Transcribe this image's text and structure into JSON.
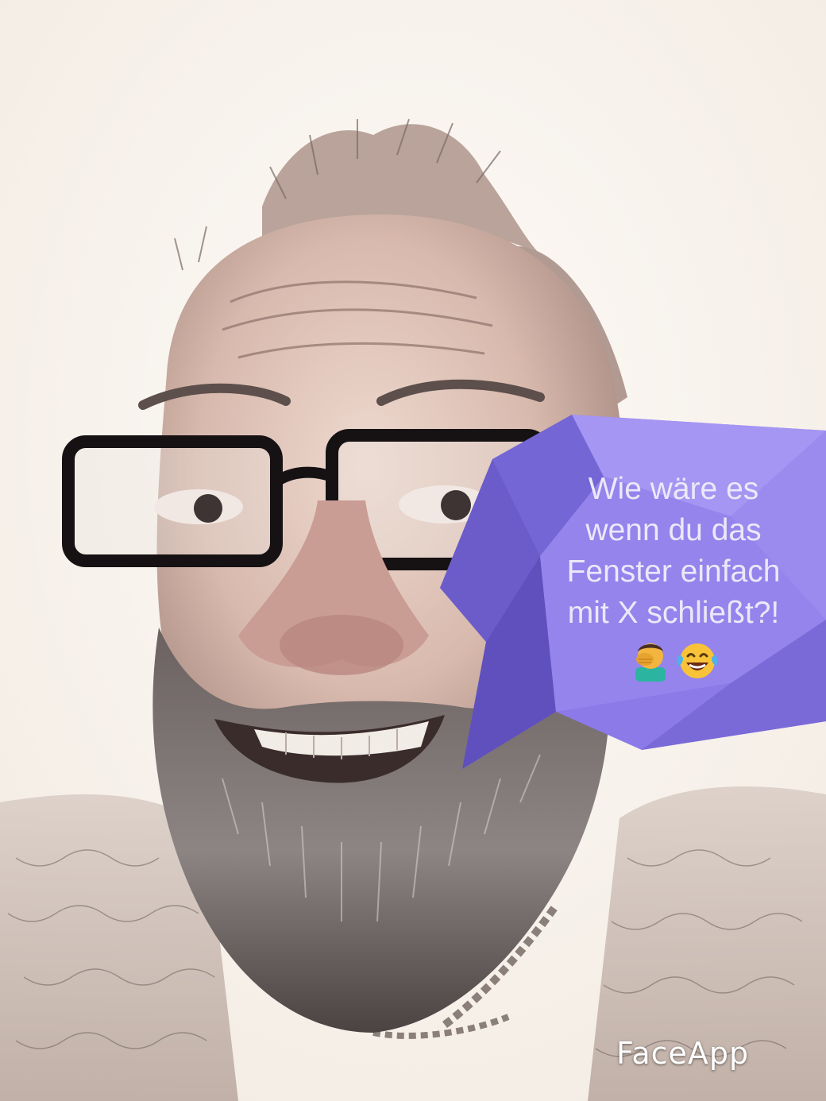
{
  "speech_bubble": {
    "lines": [
      "Wie wäre es",
      "wenn du das",
      "Fenster einfach",
      "mit X schließt?!"
    ],
    "emojis": [
      "facepalm-emoji",
      "laughing-tears-emoji"
    ],
    "color": "#8a78e6"
  },
  "watermark": {
    "text": "FaceApp"
  }
}
